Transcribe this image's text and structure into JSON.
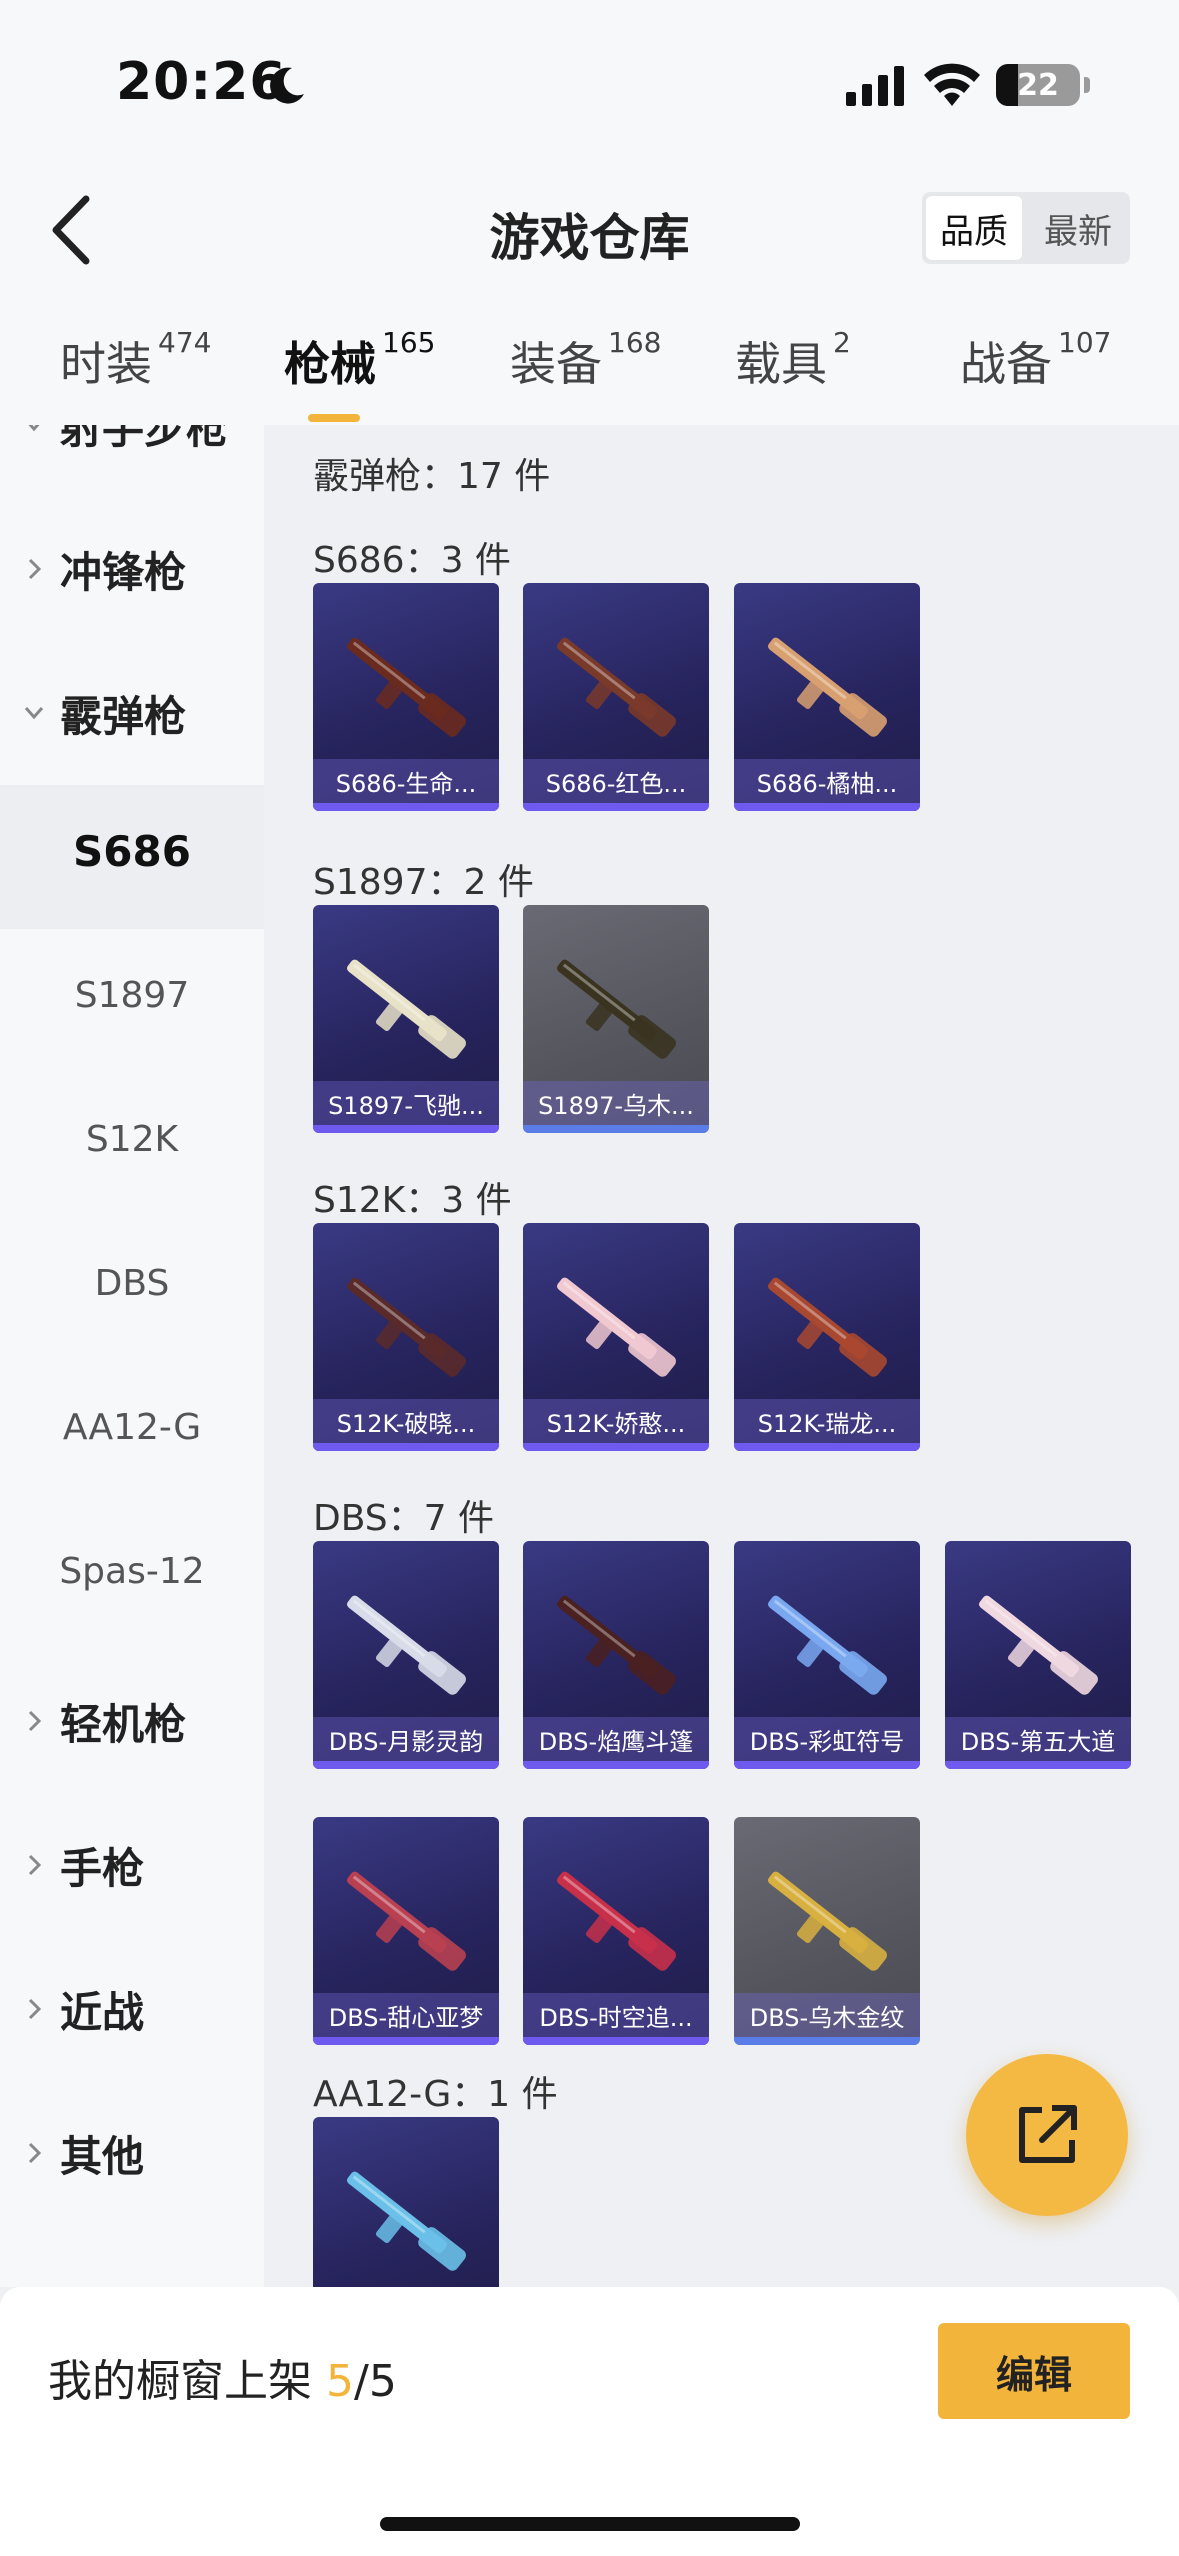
{
  "status_bar": {
    "time": "20:26",
    "battery": "22"
  },
  "header": {
    "title": "游戏仓库",
    "sort_options": [
      {
        "label": "品质",
        "active": true
      },
      {
        "label": "最新",
        "active": false
      }
    ]
  },
  "tabs": [
    {
      "label": "时装",
      "count": "474",
      "active": false
    },
    {
      "label": "枪械",
      "count": "165",
      "active": true
    },
    {
      "label": "装备",
      "count": "168",
      "active": false
    },
    {
      "label": "载具",
      "count": "2",
      "active": false
    },
    {
      "label": "战备",
      "count": "107",
      "active": false
    }
  ],
  "sidebar": {
    "partial_top": "射手步枪",
    "items": [
      {
        "label": "冲锋枪",
        "type": "category",
        "expanded": false
      },
      {
        "label": "霰弹枪",
        "type": "category",
        "expanded": true
      },
      {
        "label": "S686",
        "type": "sub",
        "selected": true
      },
      {
        "label": "S1897",
        "type": "sub",
        "selected": false
      },
      {
        "label": "S12K",
        "type": "sub",
        "selected": false
      },
      {
        "label": "DBS",
        "type": "sub",
        "selected": false
      },
      {
        "label": "AA12-G",
        "type": "sub",
        "selected": false
      },
      {
        "label": "Spas-12",
        "type": "sub",
        "selected": false
      },
      {
        "label": "轻机枪",
        "type": "category",
        "expanded": false
      },
      {
        "label": "手枪",
        "type": "category",
        "expanded": false
      },
      {
        "label": "近战",
        "type": "category",
        "expanded": false
      },
      {
        "label": "其他",
        "type": "category",
        "expanded": false
      }
    ]
  },
  "content": {
    "section_title": "霰弹枪：17 件",
    "groups": [
      {
        "title": "S686：3 件",
        "items": [
          {
            "label": "S686-生命...",
            "style": "purple",
            "gun": "#6b2a1e"
          },
          {
            "label": "S686-红色...",
            "style": "purple",
            "gun": "#7a3a2a"
          },
          {
            "label": "S686-橘柚...",
            "style": "purple",
            "gun": "#d8a070"
          }
        ]
      },
      {
        "title": "S1897：2 件",
        "items": [
          {
            "label": "S1897-飞驰...",
            "style": "purple",
            "gun": "#e8e2c8"
          },
          {
            "label": "S1897-乌木...",
            "style": "gray",
            "gun": "#3a3320"
          }
        ]
      },
      {
        "title": "S12K：3 件",
        "items": [
          {
            "label": "S12K-破晓...",
            "style": "purple",
            "gun": "#5a2a2a"
          },
          {
            "label": "S12K-娇憨...",
            "style": "purple",
            "gun": "#f0c8d0"
          },
          {
            "label": "S12K-瑞龙...",
            "style": "purple",
            "gun": "#a84830"
          }
        ]
      },
      {
        "title": "DBS：7 件",
        "items": [
          {
            "label": "DBS-月影灵韵",
            "style": "purple",
            "gun": "#d8dce8"
          },
          {
            "label": "DBS-焰鹰斗篷",
            "style": "purple",
            "gun": "#4a2020"
          },
          {
            "label": "DBS-彩虹符号",
            "style": "purple",
            "gun": "#7aa8f0"
          },
          {
            "label": "DBS-第五大道",
            "style": "purple",
            "gun": "#f0d8e0"
          },
          {
            "label": "DBS-甜心亚梦",
            "style": "purple",
            "gun": "#b84050"
          },
          {
            "label": "DBS-时空追...",
            "style": "purple",
            "gun": "#c8304a"
          },
          {
            "label": "DBS-乌木金纹",
            "style": "gray",
            "gun": "#d8b040"
          }
        ]
      },
      {
        "title": "AA12-G：1 件",
        "items": [
          {
            "label": "",
            "style": "purple",
            "gun": "#6ac0e8"
          }
        ]
      }
    ]
  },
  "bottom": {
    "showcase_prefix": "我的橱窗上架 ",
    "showcase_current": "5",
    "showcase_total": "/5",
    "edit_label": "编辑"
  },
  "colors": {
    "accent": "#f2b43a",
    "card_purple": "#2a2766",
    "card_gray": "#5a5a62"
  }
}
